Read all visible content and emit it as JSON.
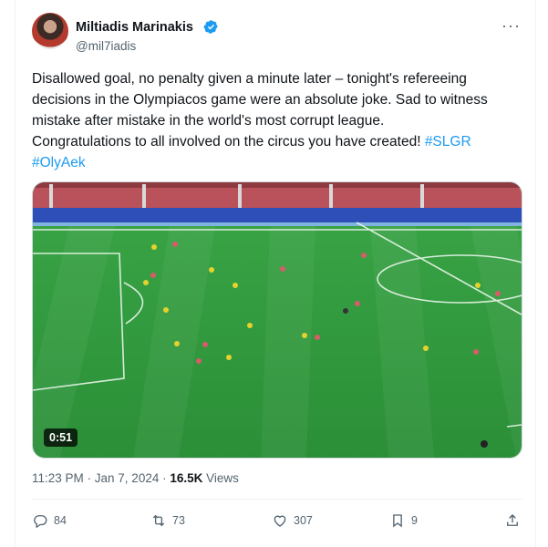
{
  "author": {
    "name": "Miltiadis Marinakis",
    "handle": "@mil7iadis"
  },
  "menu": {
    "more_icon": "more-horizontal-icon"
  },
  "tweet": {
    "text_line1": "Disallowed goal, no penalty given a minute later – tonight's refereeing",
    "text_line2": "decisions in the Olympiacos game were an absolute joke. Sad to witness",
    "text_line3": "mistake after mistake in the world's most corrupt league.",
    "text_line4": "Congratulations to all involved on the circus you have created! ",
    "hashtag1": "#SLGR",
    "hashtag2": "#OlyAek"
  },
  "media": {
    "duration": "0:51"
  },
  "meta": {
    "time_date": "11:23 PM · Jan 7, 2024 · ",
    "views_count": "16.5K",
    "views_label": " Views"
  },
  "actions": {
    "replies": "84",
    "reposts": "73",
    "likes": "307",
    "bookmarks": "9"
  },
  "colors": {
    "accent": "#1d9bf0",
    "text": "#0f1419",
    "muted": "#536471",
    "pitch": "#2f9a3b"
  }
}
